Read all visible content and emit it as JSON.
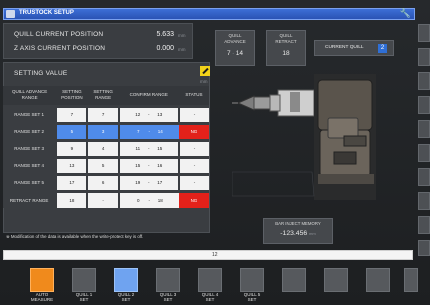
{
  "window": {
    "title": "TRUSTOCK SETUP"
  },
  "position": {
    "quill_label": "QUILL CURRENT POSITION",
    "quill_value": "5.633",
    "quill_unit": "mm",
    "z_label": "Z AXIS CURRENT POSITION",
    "z_value": "0.000",
    "z_unit": "mm"
  },
  "quill_advance": {
    "label_1": "QUILL",
    "label_2": "ADVANCE",
    "value_a": "7",
    "sep": "-",
    "value_b": "14"
  },
  "quill_retract": {
    "label_1": "QUILL",
    "label_2": "RETRACT",
    "value": "18"
  },
  "current_quill": {
    "label": "CURRENT QUILL",
    "value": "2"
  },
  "setting": {
    "title": "SETTING VALUE",
    "unit": "mm",
    "headers": [
      "QUILL ADVANCE RANGE",
      "SETTING POSITION",
      "SETTING RANGE",
      "CONFIRM RANGE",
      "STATUS"
    ],
    "rows": [
      {
        "label": "RANGE SET 1",
        "position": "7",
        "range": "7",
        "conf_a": "12",
        "conf_b": "13",
        "status": "-"
      },
      {
        "label": "RANGE SET 2",
        "position": "5",
        "range": "3",
        "conf_a": "7",
        "conf_b": "14",
        "status": "NG"
      },
      {
        "label": "RANGE SET 3",
        "position": "9",
        "range": "4",
        "conf_a": "11",
        "conf_b": "15",
        "status": "-"
      },
      {
        "label": "RANGE SET 4",
        "position": "13",
        "range": "5",
        "conf_a": "15",
        "conf_b": "16",
        "status": "-"
      },
      {
        "label": "RANGE SET 5",
        "position": "17",
        "range": "6",
        "conf_a": "19",
        "conf_b": "17",
        "status": "-"
      },
      {
        "label": "RETRACT RANGE",
        "position": "18",
        "range": "-",
        "conf_a": "0",
        "conf_b": "18",
        "status": "NG"
      }
    ],
    "conf_sep": "-"
  },
  "note": "※ Modification of the data is available when the write-protect key is off.",
  "memory": {
    "label": "BAR INJECT MEMORY",
    "value": "-123.456",
    "unit": "mm"
  },
  "message": "12",
  "function_keys": [
    {
      "label_1": "AUTO",
      "label_2": "MEASURE",
      "state": "orange"
    },
    {
      "label_1": "QUILL 1",
      "label_2": "SET",
      "state": "gray"
    },
    {
      "label_1": "QUILL 2",
      "label_2": "SET",
      "state": "blue"
    },
    {
      "label_1": "QUILL 3",
      "label_2": "SET",
      "state": "gray"
    },
    {
      "label_1": "QUILL 4",
      "label_2": "SET",
      "state": "gray"
    },
    {
      "label_1": "QUILL 5",
      "label_2": "SET",
      "state": "gray"
    }
  ],
  "colors": {
    "accent_blue": "#4f8bea",
    "ng_red": "#e3211a",
    "active_orange": "#f08a1c",
    "title_blue": "#2f5fc4"
  }
}
